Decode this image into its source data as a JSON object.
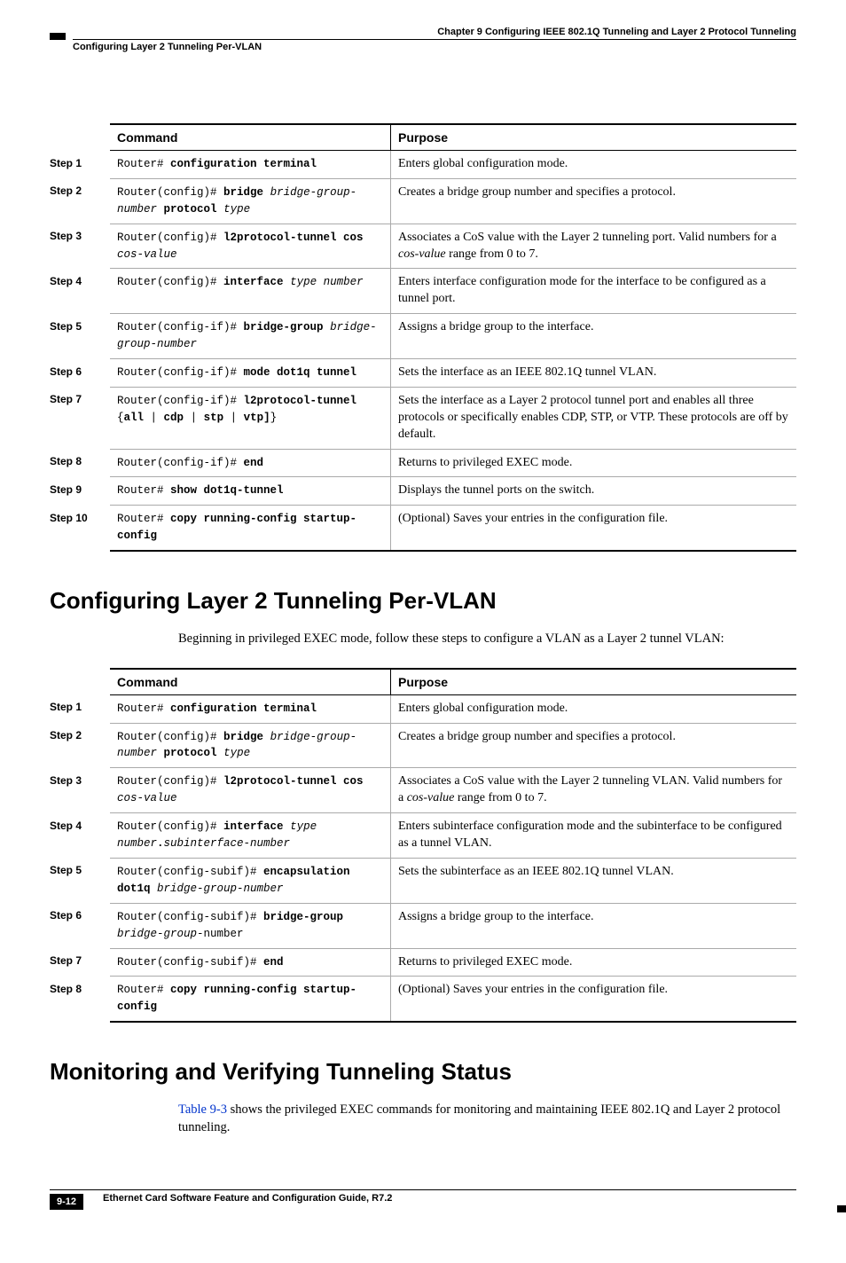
{
  "header": {
    "chapter_line": "Chapter 9 Configuring IEEE 802.1Q Tunneling and Layer 2 Protocol Tunneling",
    "breadcrumb": "Configuring Layer 2 Tunneling Per-VLAN"
  },
  "table1": {
    "col_command": "Command",
    "col_purpose": "Purpose",
    "rows": [
      {
        "step": "Step 1",
        "cmd_html": "Router# <b>configuration terminal</b>",
        "purpose_html": "Enters global configuration mode."
      },
      {
        "step": "Step 2",
        "cmd_html": "Router(config)# <b>bridge</b> <i>bridge-group-number</i> <b>protocol</b> <i>type</i>",
        "purpose_html": "Creates a bridge group number and specifies a protocol."
      },
      {
        "step": "Step 3",
        "cmd_html": "Router(config)# <b>l2protocol-tunnel cos</b> <i>cos-value</i>",
        "purpose_html": "Associates a CoS value with the Layer 2 tunneling port. Valid numbers for a <em class='param'>cos-value</em> range from 0 to 7."
      },
      {
        "step": "Step 4",
        "cmd_html": "Router(config)# <b>interface</b> <i>type number</i>",
        "purpose_html": "Enters interface configuration mode for the interface to be configured as a tunnel port."
      },
      {
        "step": "Step 5",
        "cmd_html": "Router(config-if)# <b>bridge-group</b> <i>bridge-group-number</i>",
        "purpose_html": "Assigns a bridge group to the interface."
      },
      {
        "step": "Step 6",
        "cmd_html": "Router(config-if)# <b>mode dot1q tunnel</b>",
        "purpose_html": "Sets the interface as an IEEE 802.1Q tunnel VLAN."
      },
      {
        "step": "Step 7",
        "cmd_html": "Router(config-if)# <b>l2protocol-tunnel</b> {<b>all</b> | <b>cdp</b> | <b>stp</b> | <b>vtp]</b>}",
        "purpose_html": "Sets the interface as a Layer 2 protocol tunnel port and enables all three protocols or specifically enables CDP, STP, or VTP. These protocols are off by default."
      },
      {
        "step": "Step 8",
        "cmd_html": "Router(config-if)# <b>end</b>",
        "purpose_html": "Returns to privileged EXEC mode."
      },
      {
        "step": "Step 9",
        "cmd_html": "Router# <b>show dot1q-tunnel</b>",
        "purpose_html": "Displays the tunnel ports on the switch."
      },
      {
        "step": "Step 10",
        "cmd_html": "Router# <b>copy running-config startup-config</b>",
        "purpose_html": "(Optional) Saves your entries in the configuration file."
      }
    ]
  },
  "section1": {
    "title": "Configuring Layer 2 Tunneling Per-VLAN",
    "intro": "Beginning in privileged EXEC mode, follow these steps to configure a VLAN as a Layer 2 tunnel VLAN:"
  },
  "table2": {
    "col_command": "Command",
    "col_purpose": "Purpose",
    "rows": [
      {
        "step": "Step 1",
        "cmd_html": "Router# <b>configuration terminal</b>",
        "purpose_html": "Enters global configuration mode."
      },
      {
        "step": "Step 2",
        "cmd_html": "Router(config)# <b>bridge</b> <i>bridge-group-number</i> <b>protocol</b> <i>type</i>",
        "purpose_html": "Creates a bridge group number and specifies a protocol."
      },
      {
        "step": "Step 3",
        "cmd_html": "Router(config)# <b>l2protocol-tunnel cos</b> <i>cos-value</i>",
        "purpose_html": "Associates a CoS value with the Layer 2 tunneling VLAN. Valid numbers for a <em class='param'>cos-value</em> range from 0 to 7."
      },
      {
        "step": "Step 4",
        "cmd_html": "Router(config)# <b>interface</b> <i>type number</i><b>.</b><i>subinterface-number</i>",
        "purpose_html": "Enters subinterface configuration mode and the subinterface to be configured as a tunnel VLAN."
      },
      {
        "step": "Step 5",
        "cmd_html": "Router(config-subif)# <b>encapsulation dot1q</b> <i>bridge-group-number</i>",
        "purpose_html": "Sets the subinterface as an IEEE 802.1Q tunnel VLAN."
      },
      {
        "step": "Step 6",
        "cmd_html": "Router(config-subif)# <b>bridge-group</b> <i>bridge-group-</i>number",
        "purpose_html": "Assigns a bridge group to the interface."
      },
      {
        "step": "Step 7",
        "cmd_html": "Router(config-subif)# <b>end</b>",
        "purpose_html": "Returns to privileged EXEC mode."
      },
      {
        "step": "Step 8",
        "cmd_html": "Router# <b>copy running-config startup-config</b>",
        "purpose_html": "(Optional) Saves your entries in the configuration file."
      }
    ]
  },
  "section2": {
    "title": "Monitoring and Verifying Tunneling Status",
    "intro_prefix": "",
    "xref": "Table 9-3",
    "intro_suffix": " shows the privileged EXEC commands for monitoring and maintaining IEEE 802.1Q and Layer 2 protocol tunneling."
  },
  "footer": {
    "doc_title": "Ethernet Card Software Feature and Configuration Guide, R7.2",
    "page": "9-12"
  }
}
